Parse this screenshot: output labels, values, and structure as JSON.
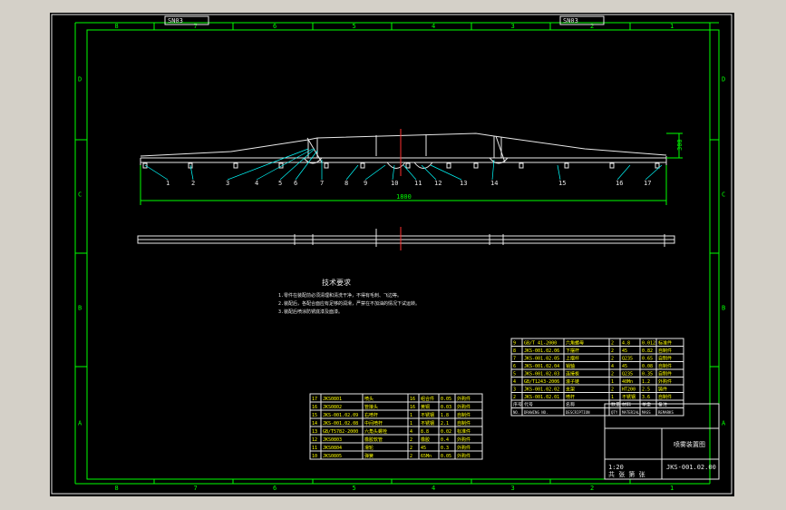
{
  "colors": {
    "frame": "#e8e8e8",
    "border": "#00ff00",
    "leader": "#00ffff",
    "dimension": "#00ff00",
    "section_line": "#ff3030",
    "table_text": "#ffff00"
  },
  "zones": {
    "top": [
      "8",
      "7",
      "6",
      "5",
      "4",
      "3",
      "2",
      "1"
    ],
    "bottom": [
      "8",
      "7",
      "6",
      "5",
      "4",
      "3",
      "2",
      "1"
    ],
    "left": [
      "A",
      "B",
      "C",
      "D"
    ],
    "right": [
      "A",
      "B",
      "C",
      "D"
    ]
  },
  "corner_top_left": "SN03",
  "corner_top_right": "SN03",
  "balloons": [
    "1",
    "2",
    "3",
    "4",
    "5",
    "6",
    "7",
    "8",
    "9",
    "10",
    "11",
    "12",
    "13",
    "14",
    "15",
    "16",
    "17"
  ],
  "dim_overall_width": "1800",
  "dim_height": "300",
  "tech_title": "技术要求",
  "tech_notes": [
    "1.零件在装配前必须清理和清洗干净，不得有毛刺、飞边等。",
    "2.装配后，各配合面应有足够的润滑，严禁在不加油的情况下试运转。",
    "3.装配后喷涂防锈底漆及面漆。"
  ],
  "bom_upper": [
    {
      "no": "9",
      "code": "GB/T 41-2000",
      "name": "六角螺母",
      "qty": "2",
      "mat": "4.8",
      "mass": "0.012",
      "note": "标准件"
    },
    {
      "no": "8",
      "code": "JKS-001.02.06",
      "name": "下摆杆",
      "qty": "2",
      "mat": "45",
      "mass": "0.82",
      "note": "自制件"
    },
    {
      "no": "7",
      "code": "JKS-001.02.05",
      "name": "上摆杆",
      "qty": "2",
      "mat": "Q235",
      "mass": "0.65",
      "note": "自制件"
    },
    {
      "no": "6",
      "code": "JKS-001.02.04",
      "name": "销轴",
      "qty": "4",
      "mat": "45",
      "mass": "0.08",
      "note": "自制件"
    },
    {
      "no": "5",
      "code": "JKS-001.02.03",
      "name": "连接板",
      "qty": "2",
      "mat": "Q235",
      "mass": "0.35",
      "note": "自制件"
    },
    {
      "no": "4",
      "code": "GB/T1243-2006",
      "name": "滚子链",
      "qty": "1",
      "mat": "40Mn",
      "mass": "1.2",
      "note": "外购件"
    },
    {
      "no": "3",
      "code": "JKS-001.02.02",
      "name": "支架",
      "qty": "2",
      "mat": "HT200",
      "mass": "2.5",
      "note": "铸件"
    },
    {
      "no": "2",
      "code": "JKS-001.02.01",
      "name": "喷杆",
      "qty": "1",
      "mat": "不锈钢",
      "mass": "3.6",
      "note": "自制件"
    }
  ],
  "bom_upper_header": [
    "序号",
    "代号",
    "名称",
    "数量",
    "材料",
    "单重",
    "备注"
  ],
  "bom_upper_header_en": [
    "NO.",
    "DRAWING NO.",
    "DESCRIPTION",
    "QTY",
    "MATERIAL",
    "MASS",
    "REMARKS"
  ],
  "bom_lower": [
    {
      "no": "17",
      "code": "JKS0801",
      "name": "喷头",
      "qty": "16",
      "mat": "组合件",
      "mass": "0.05",
      "note": "外购件"
    },
    {
      "no": "16",
      "code": "JKS0802",
      "name": "管接头",
      "qty": "16",
      "mat": "黄铜",
      "mass": "0.03",
      "note": "外购件"
    },
    {
      "no": "15",
      "code": "JKS-001.02.09",
      "name": "右喷杆",
      "qty": "1",
      "mat": "不锈钢",
      "mass": "1.8",
      "note": "自制件"
    },
    {
      "no": "14",
      "code": "JKS-001.02.08",
      "name": "中间喷杆",
      "qty": "1",
      "mat": "不锈钢",
      "mass": "2.1",
      "note": "自制件"
    },
    {
      "no": "13",
      "code": "GB/T5782-2000",
      "name": "六角头螺栓",
      "qty": "4",
      "mat": "8.8",
      "mass": "0.02",
      "note": "标准件"
    },
    {
      "no": "12",
      "code": "JKS0803",
      "name": "橡胶软管",
      "qty": "2",
      "mat": "橡胶",
      "mass": "0.4",
      "note": "外购件"
    },
    {
      "no": "11",
      "code": "JKS0804",
      "name": "滑轮",
      "qty": "2",
      "mat": "45",
      "mass": "0.3",
      "note": "外购件"
    },
    {
      "no": "10",
      "code": "JKS0805",
      "name": "弹簧",
      "qty": "2",
      "mat": "65Mn",
      "mass": "0.05",
      "note": "外购件"
    }
  ],
  "title_block": {
    "drawing_name": "喷雾装置图",
    "drawing_no": "JKS-001.02.00",
    "scale": "1:20",
    "sheet": "共 张 第 张",
    "labels": [
      "标准化",
      "批准",
      "设计",
      "审核",
      "工艺",
      "日期"
    ]
  }
}
